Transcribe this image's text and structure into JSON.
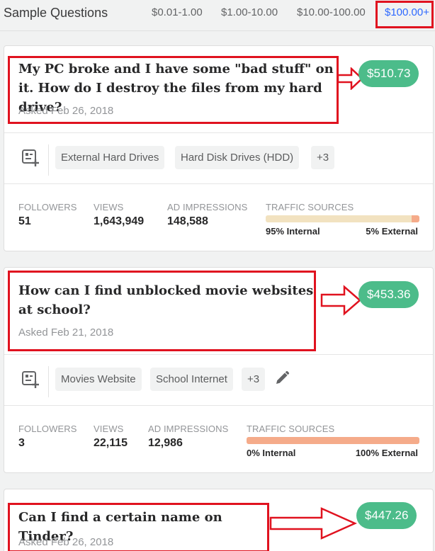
{
  "header": {
    "title": "Sample Questions",
    "ranges": [
      {
        "label": "$0.01-1.00",
        "active": false
      },
      {
        "label": "$1.00-10.00",
        "active": false
      },
      {
        "label": "$10.00-100.00",
        "active": false
      },
      {
        "label": "$100.00+",
        "active": true
      }
    ]
  },
  "stat_labels": {
    "followers": "FOLLOWERS",
    "views": "VIEWS",
    "ad_impressions": "AD IMPRESSIONS",
    "traffic_sources": "TRAFFIC SOURCES"
  },
  "questions": [
    {
      "title": "My PC broke and I have some \"bad stuff\" on it. How do I destroy the files from my hard drive?",
      "asked": "Asked Feb 26, 2018",
      "price": "$510.73",
      "topics": [
        "External Hard Drives",
        "Hard Disk Drives (HDD)"
      ],
      "more_topics": "+3",
      "followers": "51",
      "views": "1,643,949",
      "ad_impressions": "148,588",
      "internal_pct": 95,
      "internal_label": "95% Internal",
      "external_label": "5% External"
    },
    {
      "title": "How can I find unblocked movie websites at school?",
      "asked": "Asked Feb 21, 2018",
      "price": "$453.36",
      "topics": [
        "Movies Website",
        "School Internet"
      ],
      "more_topics": "+3",
      "followers": "3",
      "views": "22,115",
      "ad_impressions": "12,986",
      "internal_pct": 0,
      "internal_label": "0% Internal",
      "external_label": "100% External"
    },
    {
      "title": "Can I find a certain name on Tinder?",
      "asked": "Asked Feb 26, 2018",
      "price": "$447.26"
    }
  ],
  "colors": {
    "price_green": "#4cbc8a",
    "highlight_red": "#e0121f",
    "link_blue": "#2e69ff",
    "internal_bar": "#f2e2c0",
    "external_bar": "#f5ab8a"
  },
  "icons": {
    "topic": "topic-list-icon",
    "edit": "pencil-icon",
    "annotation": "red-arrow-icon"
  }
}
